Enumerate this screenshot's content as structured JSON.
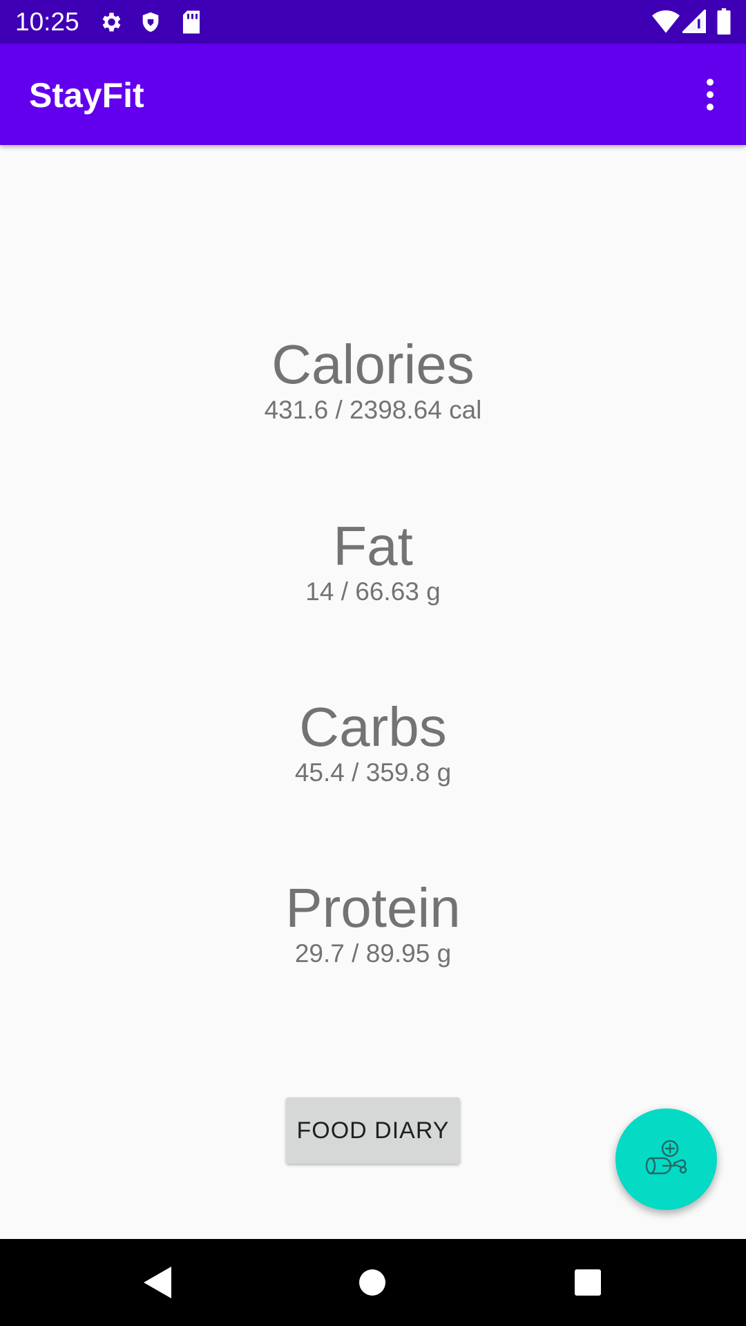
{
  "status_bar": {
    "time": "10:25",
    "left_icons": [
      "gear-icon",
      "shield-icon",
      "sd-card-icon"
    ],
    "right_icons": [
      "wifi-icon",
      "signal-icon",
      "battery-icon"
    ]
  },
  "app_bar": {
    "title": "StayFit",
    "overflow_icon": "more-vert-icon"
  },
  "stats": [
    {
      "label": "Calories",
      "value": "431.6 / 2398.64 cal"
    },
    {
      "label": "Fat",
      "value": "14 / 66.63 g"
    },
    {
      "label": "Carbs",
      "value": "45.4 / 359.8 g"
    },
    {
      "label": "Protein",
      "value": "29.7 / 89.95 g"
    }
  ],
  "food_diary_button": {
    "label": "FOOD DIARY"
  },
  "fab": {
    "icon": "add-workout-icon"
  },
  "nav_bar": {
    "icons": [
      "back-icon",
      "home-icon",
      "recents-icon"
    ]
  },
  "colors": {
    "status_bar": "#3f00b5",
    "app_bar": "#6200ee",
    "fab": "#05dac5",
    "text_secondary": "#737373",
    "button_bg": "#d6d7d7"
  }
}
